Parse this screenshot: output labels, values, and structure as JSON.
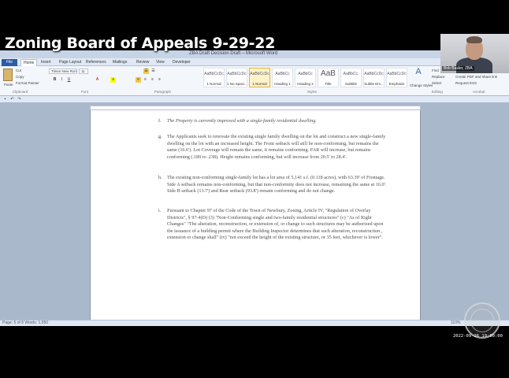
{
  "video": {
    "title": "Zoning Board of Appeals 9-29-22",
    "timestamp": "2022-09-26 19:00:00"
  },
  "webcam": {
    "name": "Bob Basler, ZBA"
  },
  "word": {
    "window_title": "ZBA Draft Decision Draft – Microsoft Word",
    "tabs": [
      "File",
      "Home",
      "Insert",
      "Page Layout",
      "References",
      "Mailings",
      "Review",
      "View",
      "Developer"
    ],
    "ribbon": {
      "clipboard": {
        "paste": "Paste",
        "cut": "Cut",
        "copy": "Copy",
        "format_painter": "Format Painter",
        "label": "Clipboard"
      },
      "font": {
        "name": "Times New Roman",
        "size": "11",
        "label": "Font"
      },
      "paragraph": {
        "label": "Paragraph"
      },
      "styles": {
        "label": "Styles",
        "items": [
          {
            "preview": "AaBbCcDc",
            "name": "1 Normal"
          },
          {
            "preview": "AaBbCcDc",
            "name": "1 No Spaci..."
          },
          {
            "preview": "AaBbCcDc",
            "name": "1 Normal",
            "selected": true
          },
          {
            "preview": "AaBbCc",
            "name": "Heading 1"
          },
          {
            "preview": "AaBbCc",
            "name": "Heading 2"
          },
          {
            "preview": "AaB",
            "name": "Title"
          },
          {
            "preview": "AaBbCc.",
            "name": "Subtitle"
          },
          {
            "preview": "AaBbCcDc",
            "name": "Subtle Em..."
          },
          {
            "preview": "AaBbCcDc",
            "name": "Emphasis"
          }
        ],
        "change_styles": "Change Styles"
      },
      "editing": {
        "find": "Find",
        "replace": "Replace",
        "select": "Select",
        "label": "Editing"
      },
      "acrobat": {
        "label": "Acrobat",
        "items": [
          "Create PDF",
          "Create PDF and share link",
          "Request ESS"
        ]
      }
    },
    "document": {
      "paragraphs": [
        {
          "label": "f.",
          "text": "The Property is currently improved with a single-family residential dwelling."
        },
        {
          "label": "g.",
          "text": "The Applicants seek to renovate the existing single family dwelling on the lot and construct a new single-family dwelling on the lot with an increased height. The Front setback will still be non-conforming, but remains the same (16.6'). Lot Coverage will remain the same, it remains conforming. FAR will increase, but remains conforming (.189 to .238). Height remains conforming, but will increase from 20.5' to 28.4'."
        },
        {
          "label": "h.",
          "text": "The existing non-conforming single-family lot has a lot area of 5,141 s.f. (0.118 acres), with 63.39' of Frontage. Side A setback remains non-conforming, but that non-conformity does not increase, remaining the same at 16.0'. Side B setback (13.7') and Rear setback (93.8') remain conforming and do not change."
        },
        {
          "label": "i.",
          "text": "Pursuant to Chapter 97 of the Code of the Town of Newbury, Zoning, Article IV, \"Regulation of Overlay Districts\", § 97-4(D) (3) \"Non-Conforming single and two-family residential structures\" (c) \"As of Right Changes\" \"The alteration, reconstruction, or extension of, or change to such structures may be authorized upon the issuance of a building permit where the Building Inspector determines that such alteration, reconstruction , extension or change shall\" (iv) \"not exceed the height of the existing structure, or 35 feet, whichever is lower\"."
        }
      ]
    },
    "status": {
      "left": "Page: 5 of 8   Words: 1,950",
      "zoom": "110%"
    }
  }
}
